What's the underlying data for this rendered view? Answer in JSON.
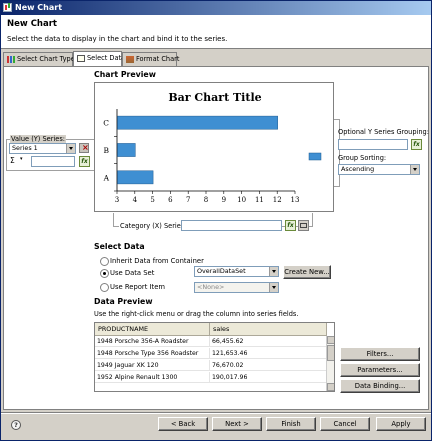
{
  "window": {
    "title": "New Chart"
  },
  "header": {
    "title": "New Chart",
    "description": "Select the data to display in the chart and bind it to the series."
  },
  "tabs": [
    {
      "label": "Select Chart Type",
      "icon": "chart-type-icon"
    },
    {
      "label": "Select Data",
      "icon": "select-data-icon"
    },
    {
      "label": "Format Chart",
      "icon": "format-chart-icon"
    }
  ],
  "chart_preview": {
    "label": "Chart Preview",
    "chart_data": {
      "type": "bar",
      "orientation": "horizontal",
      "title": "Bar Chart Title",
      "categories": [
        "A",
        "B",
        "C"
      ],
      "values": [
        5,
        4,
        12
      ],
      "xlim": [
        3,
        13
      ],
      "x_ticks": [
        "3",
        "4",
        "5",
        "6",
        "7",
        "8",
        "9",
        "10",
        "11",
        "12",
        "13"
      ],
      "bar_color": "#3f8fd2",
      "legend_swatch_color": "#3f8fd2",
      "grid": false
    }
  },
  "value_series": {
    "label": "Value (Y) Series:",
    "series_selected": "Series 1",
    "sigma_symbol": "Σ",
    "fx_label": "fx"
  },
  "optional_grouping": {
    "label": "Optional Y Series Grouping:",
    "group_sorting_label": "Group Sorting:",
    "group_sorting_value": "Ascending"
  },
  "category_series": {
    "label": "Category (X) Series:"
  },
  "select_data": {
    "label": "Select Data",
    "options": [
      {
        "label": "Inherit Data from Container",
        "checked": false
      },
      {
        "label": "Use Data Set",
        "checked": true
      },
      {
        "label": "Use Report Item",
        "checked": false
      }
    ],
    "dataset_value": "OverallDataSet",
    "report_item_value": "<None>",
    "create_new_label": "Create New..."
  },
  "data_preview": {
    "label": "Data Preview",
    "hint": "Use the right-click menu or drag the column into series fields.",
    "columns": [
      "PRODUCTNAME",
      "sales"
    ],
    "rows": [
      [
        "1948 Porsche 356-A Roadster",
        "66,455.62"
      ],
      [
        "1948 Porsche Type 356 Roadster",
        "121,653.46"
      ],
      [
        "1949 Jaguar XK 120",
        "76,670.02"
      ],
      [
        "1952 Alpine Renault 1300",
        "190,017.96"
      ]
    ]
  },
  "side_buttons": {
    "filters": "Filters...",
    "parameters": "Parameters...",
    "data_binding": "Data Binding..."
  },
  "footer": {
    "help": "?",
    "back": "< Back",
    "next": "Next >",
    "finish": "Finish",
    "cancel": "Cancel",
    "apply": "Apply"
  }
}
